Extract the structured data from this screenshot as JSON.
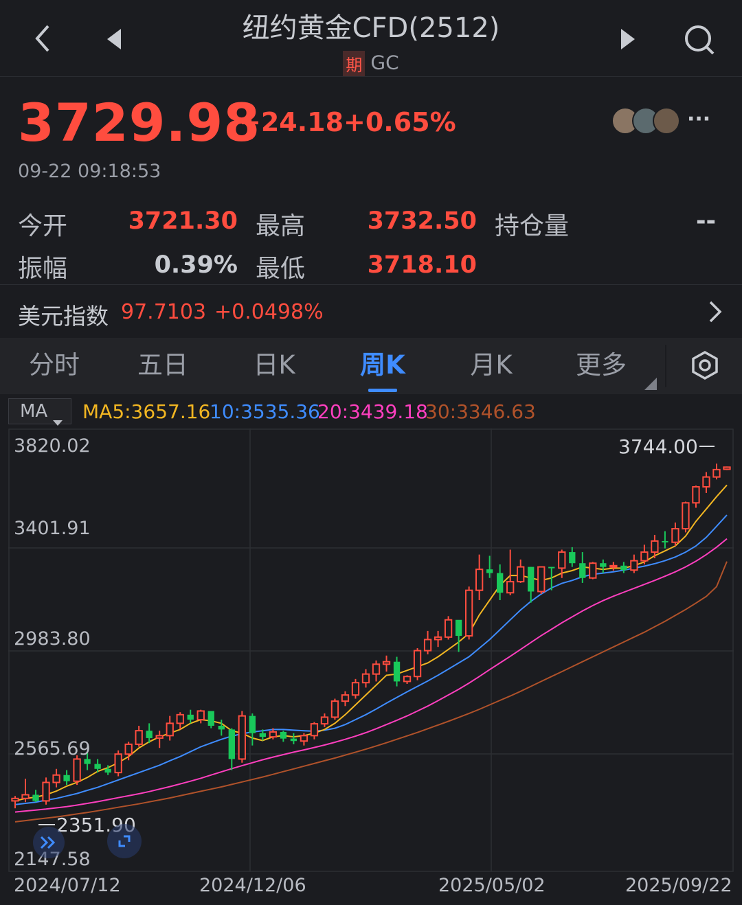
{
  "header": {
    "title": "纽约黄金CFD(2512)",
    "tag": "期",
    "code": "GC",
    "icons": [
      "back-arrow-icon",
      "prev-triangle-icon",
      "next-triangle-icon",
      "search-icon"
    ]
  },
  "quote": {
    "price": "3729.98",
    "change": "+24.18",
    "change_pct": "+0.65%",
    "timestamp": "09-22 09:18:53",
    "more": "···"
  },
  "stats": {
    "open_label": "今开",
    "open_value": "3721.30",
    "high_label": "最高",
    "high_value": "3732.50",
    "oi_label": "持仓量",
    "oi_value": "--",
    "amp_label": "振幅",
    "amp_value": "0.39%",
    "low_label": "最低",
    "low_value": "3718.10"
  },
  "dxy": {
    "label": "美元指数",
    "value": "97.7103",
    "change": "+0.0498%"
  },
  "tabs": [
    {
      "label": "分时"
    },
    {
      "label": "五日"
    },
    {
      "label": "日K"
    },
    {
      "label": "周K",
      "active": true
    },
    {
      "label": "月K"
    },
    {
      "label": "更多"
    }
  ],
  "ma": {
    "selector": "MA",
    "ma5": "MA5:3657.16",
    "ma10": "10:3535.36",
    "ma20": "20:3439.18",
    "ma30": "30:3346.63"
  },
  "colors": {
    "up": "#ff4d3f",
    "down": "#19c85a",
    "ma5": "#f2b622",
    "ma10": "#3f8cff",
    "ma20": "#ff3fbf",
    "ma30": "#b0522a"
  },
  "chart_data": {
    "type": "candlestick",
    "y_ticks": [
      "3820.02",
      "3401.91",
      "2983.80",
      "2565.69",
      "2147.58"
    ],
    "ylim": [
      2147.58,
      3820.02
    ],
    "x_ticks": [
      "2024/07/12",
      "2024/12/06",
      "2025/05/02",
      "2025/09/22"
    ],
    "high_marker": "3744.00",
    "low_marker": "2351.90",
    "ohlc": [
      [
        2375,
        2395,
        2345,
        2385
      ],
      [
        2385,
        2465,
        2370,
        2400
      ],
      [
        2400,
        2420,
        2370,
        2375
      ],
      [
        2375,
        2470,
        2360,
        2450
      ],
      [
        2450,
        2505,
        2430,
        2480
      ],
      [
        2480,
        2500,
        2440,
        2455
      ],
      [
        2455,
        2560,
        2440,
        2545
      ],
      [
        2545,
        2570,
        2500,
        2525
      ],
      [
        2525,
        2545,
        2490,
        2505
      ],
      [
        2505,
        2520,
        2480,
        2490
      ],
      [
        2490,
        2580,
        2475,
        2565
      ],
      [
        2565,
        2615,
        2540,
        2605
      ],
      [
        2605,
        2680,
        2595,
        2660
      ],
      [
        2660,
        2690,
        2610,
        2630
      ],
      [
        2630,
        2660,
        2590,
        2640
      ],
      [
        2640,
        2720,
        2620,
        2690
      ],
      [
        2690,
        2735,
        2665,
        2725
      ],
      [
        2725,
        2745,
        2690,
        2705
      ],
      [
        2705,
        2745,
        2690,
        2740
      ],
      [
        2740,
        2735,
        2670,
        2680
      ],
      [
        2680,
        2705,
        2640,
        2665
      ],
      [
        2665,
        2670,
        2500,
        2545
      ],
      [
        2545,
        2740,
        2530,
        2720
      ],
      [
        2720,
        2730,
        2600,
        2650
      ],
      [
        2650,
        2665,
        2620,
        2635
      ],
      [
        2635,
        2670,
        2625,
        2655
      ],
      [
        2655,
        2660,
        2615,
        2628
      ],
      [
        2628,
        2650,
        2605,
        2618
      ],
      [
        2618,
        2650,
        2600,
        2640
      ],
      [
        2640,
        2695,
        2625,
        2688
      ],
      [
        2688,
        2730,
        2675,
        2715
      ],
      [
        2715,
        2790,
        2705,
        2780
      ],
      [
        2780,
        2820,
        2760,
        2805
      ],
      [
        2805,
        2870,
        2790,
        2855
      ],
      [
        2855,
        2910,
        2835,
        2890
      ],
      [
        2890,
        2945,
        2860,
        2930
      ],
      [
        2930,
        2965,
        2900,
        2940
      ],
      [
        2940,
        2960,
        2840,
        2860
      ],
      [
        2860,
        2885,
        2850,
        2880
      ],
      [
        2880,
        2995,
        2865,
        2985
      ],
      [
        2985,
        3065,
        2970,
        3030
      ],
      [
        3030,
        3065,
        3000,
        3040
      ],
      [
        3040,
        3125,
        3030,
        3110
      ],
      [
        3110,
        3075,
        2980,
        3045
      ],
      [
        3045,
        3245,
        3030,
        3230
      ],
      [
        3230,
        3375,
        3190,
        3315
      ],
      [
        3315,
        3370,
        3280,
        3300
      ],
      [
        3300,
        3335,
        3190,
        3220
      ],
      [
        3220,
        3395,
        3210,
        3265
      ],
      [
        3265,
        3355,
        3260,
        3325
      ],
      [
        3325,
        3325,
        3180,
        3225
      ],
      [
        3225,
        3325,
        3215,
        3325
      ],
      [
        3325,
        3325,
        3230,
        3320
      ],
      [
        3320,
        3395,
        3280,
        3385
      ],
      [
        3385,
        3405,
        3325,
        3340
      ],
      [
        3340,
        3385,
        3260,
        3280
      ],
      [
        3280,
        3345,
        3275,
        3340
      ],
      [
        3340,
        3355,
        3300,
        3325
      ],
      [
        3325,
        3345,
        3310,
        3330
      ],
      [
        3330,
        3345,
        3300,
        3312
      ],
      [
        3312,
        3375,
        3300,
        3350
      ],
      [
        3350,
        3415,
        3335,
        3385
      ],
      [
        3385,
        3455,
        3360,
        3430
      ],
      [
        3430,
        3470,
        3400,
        3425
      ],
      [
        3425,
        3505,
        3410,
        3480
      ],
      [
        3480,
        3590,
        3465,
        3585
      ],
      [
        3585,
        3655,
        3565,
        3650
      ],
      [
        3650,
        3710,
        3625,
        3690
      ],
      [
        3690,
        3744,
        3680,
        3720
      ],
      [
        3721.3,
        3732.5,
        3718.1,
        3729.98
      ]
    ],
    "ma5": [
      2375,
      2385,
      2390,
      2400,
      2415,
      2435,
      2450,
      2470,
      2495,
      2510,
      2530,
      2555,
      2590,
      2615,
      2635,
      2650,
      2665,
      2690,
      2705,
      2700,
      2690,
      2660,
      2650,
      2630,
      2620,
      2635,
      2640,
      2635,
      2640,
      2650,
      2665,
      2690,
      2725,
      2765,
      2805,
      2845,
      2885,
      2890,
      2905,
      2920,
      2935,
      2960,
      2990,
      3020,
      3055,
      3130,
      3190,
      3250,
      3290,
      3290,
      3280,
      3270,
      3280,
      3300,
      3310,
      3325,
      3320,
      3315,
      3320,
      3320,
      3330,
      3345,
      3370,
      3390,
      3410,
      3450,
      3510,
      3560,
      3610,
      3657.16
    ],
    "ma10": [
      2360,
      2365,
      2370,
      2378,
      2385,
      2395,
      2405,
      2418,
      2430,
      2445,
      2460,
      2475,
      2490,
      2505,
      2520,
      2538,
      2555,
      2575,
      2595,
      2610,
      2625,
      2638,
      2648,
      2655,
      2660,
      2665,
      2665,
      2662,
      2660,
      2658,
      2662,
      2670,
      2685,
      2705,
      2725,
      2748,
      2772,
      2795,
      2818,
      2840,
      2862,
      2885,
      2910,
      2935,
      2960,
      2995,
      3030,
      3070,
      3110,
      3150,
      3185,
      3215,
      3240,
      3258,
      3270,
      3285,
      3295,
      3300,
      3305,
      3312,
      3320,
      3328,
      3338,
      3350,
      3365,
      3385,
      3410,
      3445,
      3490,
      3535.36
    ],
    "ma20": [
      2330,
      2334,
      2338,
      2342,
      2347,
      2352,
      2358,
      2365,
      2372,
      2380,
      2388,
      2396,
      2404,
      2413,
      2423,
      2433,
      2444,
      2455,
      2467,
      2480,
      2493,
      2506,
      2518,
      2530,
      2542,
      2553,
      2563,
      2573,
      2582,
      2592,
      2602,
      2613,
      2625,
      2638,
      2652,
      2668,
      2685,
      2702,
      2720,
      2740,
      2760,
      2782,
      2805,
      2828,
      2853,
      2880,
      2908,
      2935,
      2962,
      2990,
      3018,
      3046,
      3072,
      3098,
      3122,
      3146,
      3168,
      3188,
      3206,
      3222,
      3238,
      3254,
      3270,
      3287,
      3305,
      3325,
      3348,
      3375,
      3405,
      3439.18
    ],
    "ma30": [
      2290,
      2295,
      2300,
      2305,
      2310,
      2316,
      2322,
      2328,
      2335,
      2342,
      2349,
      2356,
      2363,
      2371,
      2379,
      2387,
      2396,
      2405,
      2414,
      2423,
      2432,
      2442,
      2452,
      2462,
      2472,
      2483,
      2494,
      2505,
      2516,
      2527,
      2538,
      2549,
      2561,
      2573,
      2585,
      2598,
      2611,
      2625,
      2639,
      2653,
      2668,
      2683,
      2698,
      2714,
      2730,
      2747,
      2765,
      2783,
      2801,
      2820,
      2840,
      2860,
      2880,
      2900,
      2920,
      2940,
      2960,
      2980,
      3000,
      3020,
      3040,
      3060,
      3082,
      3104,
      3128,
      3152,
      3178,
      3205,
      3245,
      3346.63
    ]
  }
}
